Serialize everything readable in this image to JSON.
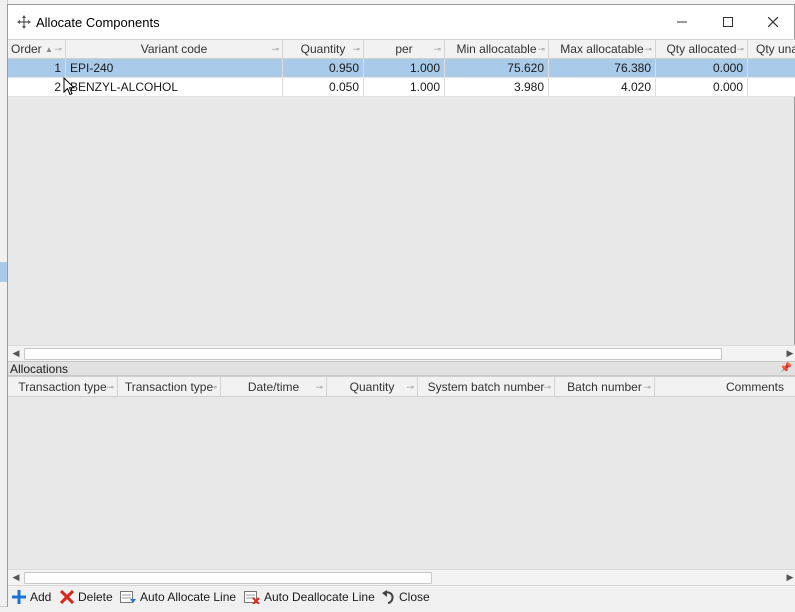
{
  "window": {
    "title": "Allocate Components",
    "minimize_label": "—",
    "maximize_label": "☐",
    "close_label": "✕"
  },
  "components_grid": {
    "columns": [
      "Order",
      "Variant code",
      "Quantity",
      "per",
      "Min allocatable",
      "Max allocatable",
      "Qty allocated",
      "Qty una"
    ],
    "rows": [
      {
        "order": "1",
        "variant_code": "EPI-240",
        "quantity": "0.950",
        "per": "1.000",
        "min_allocatable": "75.620",
        "max_allocatable": "76.380",
        "qty_allocated": "0.000",
        "qty_unallocated": ""
      },
      {
        "order": "2",
        "variant_code": "BENZYL-ALCOHOL",
        "quantity": "0.050",
        "per": "1.000",
        "min_allocatable": "3.980",
        "max_allocatable": "4.020",
        "qty_allocated": "0.000",
        "qty_unallocated": ""
      }
    ]
  },
  "allocations": {
    "panel_title": "Allocations",
    "columns": [
      "Transaction type",
      "Transaction type",
      "Date/time",
      "Quantity",
      "System batch number",
      "Batch number",
      "Comments"
    ]
  },
  "toolbar": {
    "add_label": "Add",
    "delete_label": "Delete",
    "auto_allocate_label": "Auto Allocate Line",
    "auto_deallocate_label": "Auto Deallocate Line",
    "close_label": "Close"
  },
  "colors": {
    "selection": "#a9cbe9",
    "add_icon": "#1e73d2",
    "delete_icon": "#d9261c"
  }
}
